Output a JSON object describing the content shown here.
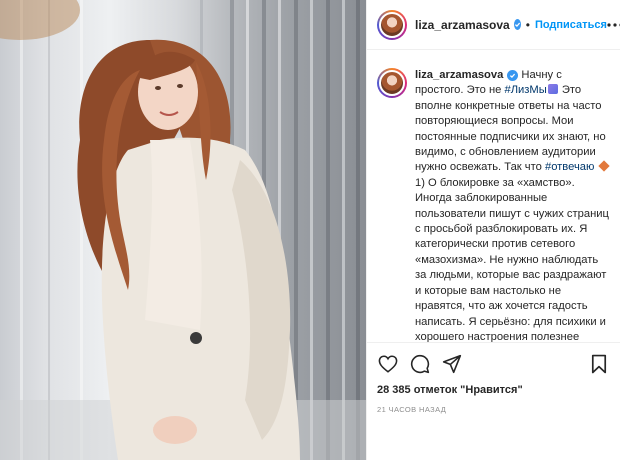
{
  "post": {
    "username": "liza_arzamasova",
    "follow_label": "Подписаться",
    "separator": "•",
    "caption": {
      "username": "liza_arzamasova",
      "t1": " Начну с простого. Это не ",
      "hashtag1": "#ЛизМы",
      "t2": " Это вполне конкретные ответы на часто повторяющиеся вопросы. Мои постоянные подписчики их знают, но видимо, с обновлением аудитории нужно освежать. Так что ",
      "hashtag2": "#отвечаю",
      "t3": "1) О блокировке за «хамство». Иногда заблокированные пользователи пишут с чужих страниц с просьбой разблокировать их. Я категорически против сетевого «мазохизма». Не нужно наблюдать за людьми, которые вас раздражают и которые вам настолько не нравятся, что аж хочется гадость написать. Я серьёзно: для психики и хорошего настроения полезнее любоваться"
    },
    "likes": "28 385 отметок \"Нравится\"",
    "time_ago": "21 часов назад"
  },
  "icons": {
    "verified": "verified-badge-icon",
    "more": "more-options-icon",
    "like": "heart-icon",
    "comment": "comment-icon",
    "share": "share-icon",
    "save": "bookmark-icon"
  },
  "colors": {
    "link_blue": "#0095f6",
    "verified_blue": "#3897f0",
    "hashtag": "#00376b",
    "text": "#262626",
    "muted": "#8e8e8e",
    "coat": "#ede7de"
  }
}
